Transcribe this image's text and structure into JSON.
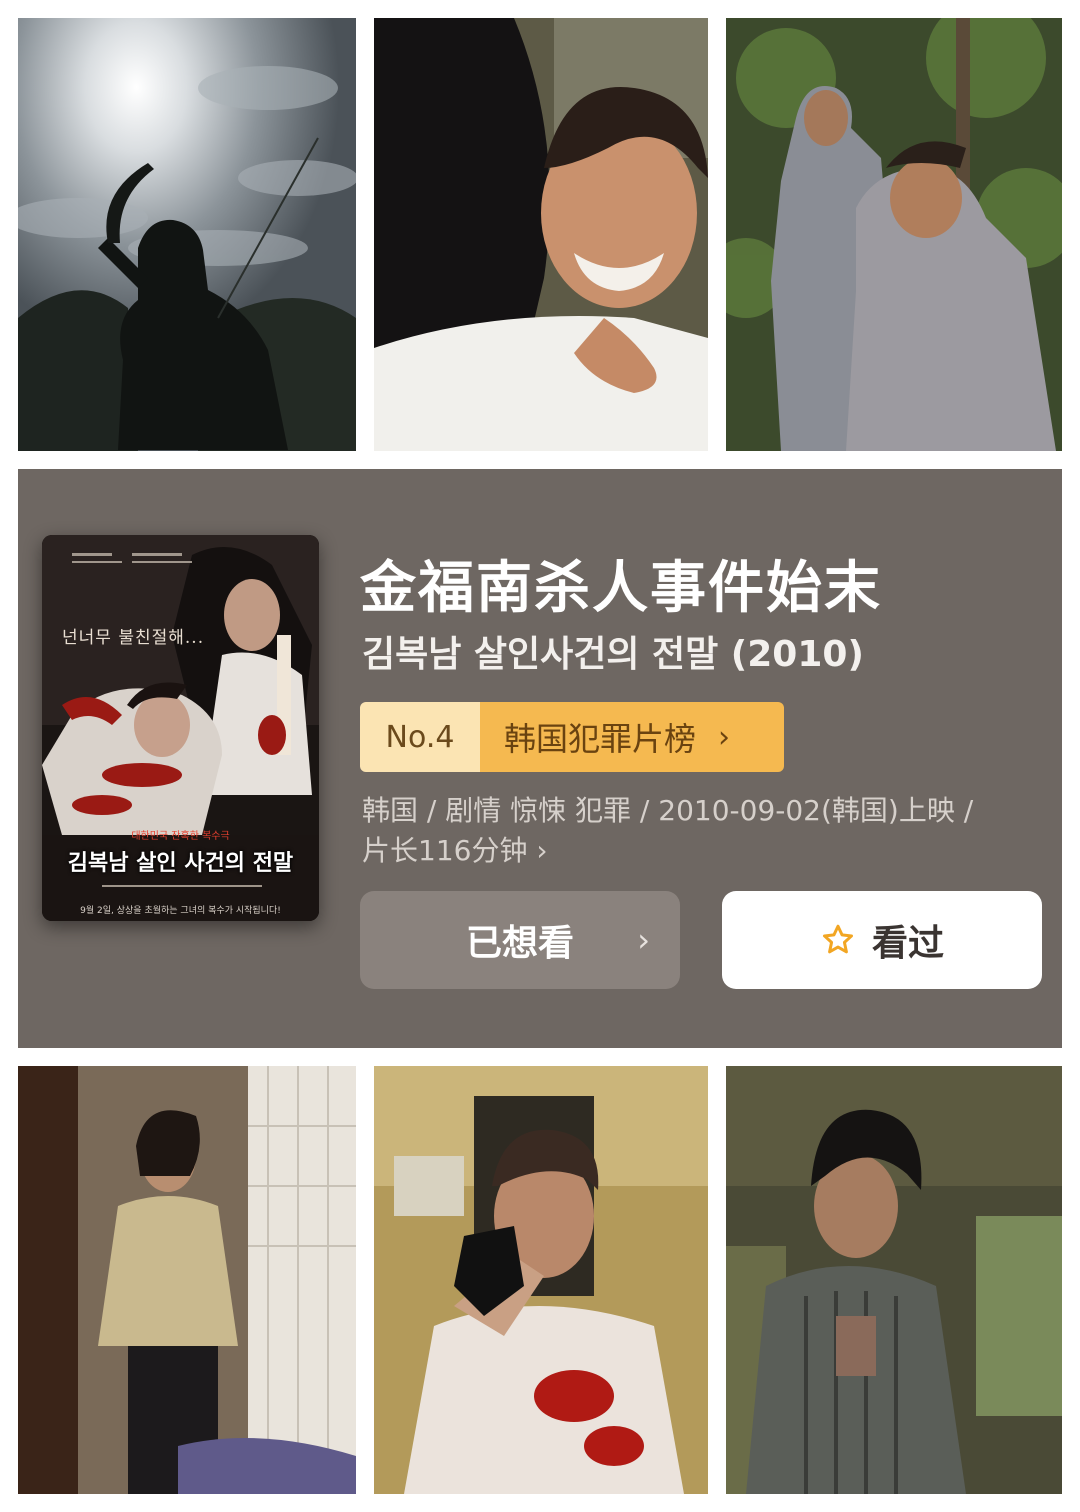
{
  "movie": {
    "title_cn": "金福南杀人事件始末",
    "title_original": "김복남 살인사건의 전말 (2010)",
    "rank": {
      "number": "No.4",
      "list_name": "韩国犯罪片榜",
      "chevron": "›",
      "color_number_bg": "#fbe4b3",
      "color_list_bg": "#f5b950"
    },
    "meta_line1": "韩国 / 剧情 惊悚 犯罪 / 2010-09-02(韩国)上映 /",
    "meta_line2": "片长116分钟 ›",
    "poster": {
      "tagline": "넌너무 불친절해...",
      "subtitle": "대한민국 잔혹한 복수극",
      "title": "김복남 살인 사건의 전말",
      "date_line": "9월 2일, 상상을 초월하는 그녀의 복수가 시작됩니다!"
    },
    "buttons": {
      "want_label": "已想看",
      "want_chevron": "›",
      "seen_label": "看过",
      "seen_icon": "star-outline-icon",
      "star_color": "#f2a623"
    }
  },
  "colors": {
    "card_bg": "#6e6762",
    "page_bg": "#ffffff"
  },
  "stills": [
    {
      "name": "still-silhouette-sickle"
    },
    {
      "name": "still-smiling-embrace"
    },
    {
      "name": "still-two-men-forest"
    },
    {
      "name": "still-woman-doorway"
    },
    {
      "name": "still-man-with-gun"
    },
    {
      "name": "still-man-in-vest"
    }
  ]
}
